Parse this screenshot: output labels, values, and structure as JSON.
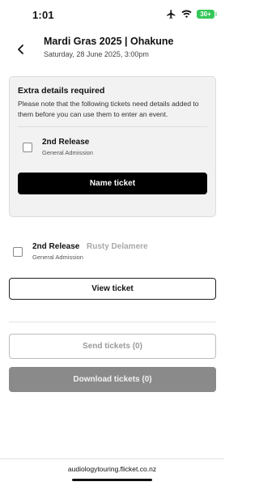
{
  "status_bar": {
    "time": "1:01",
    "battery_text": "30+",
    "battery_color": "#35c759",
    "icons": [
      "airplane-icon",
      "wifi-icon",
      "battery-icon"
    ]
  },
  "header": {
    "back_icon": "chevron-left-icon",
    "title": "Mardi Gras 2025 | Ohakune",
    "date": "Saturday, 28 June 2025, 3:00pm"
  },
  "details_card": {
    "title": "Extra details required",
    "description": "Please note that the following tickets need details added to them before you can use them to enter an event.",
    "ticket": {
      "name": "2nd Release",
      "type": "General Admission",
      "checked": false
    },
    "button_label": "Name ticket"
  },
  "ticket_row": {
    "name": "2nd Release",
    "holder": "Rusty Delamere",
    "type": "General Admission",
    "checked": false
  },
  "buttons": {
    "view_ticket": "View ticket",
    "send_tickets": "Send tickets (0)",
    "download_tickets": "Download tickets (0)"
  },
  "footer": {
    "url": "audiologytouring.flicket.co.nz"
  }
}
